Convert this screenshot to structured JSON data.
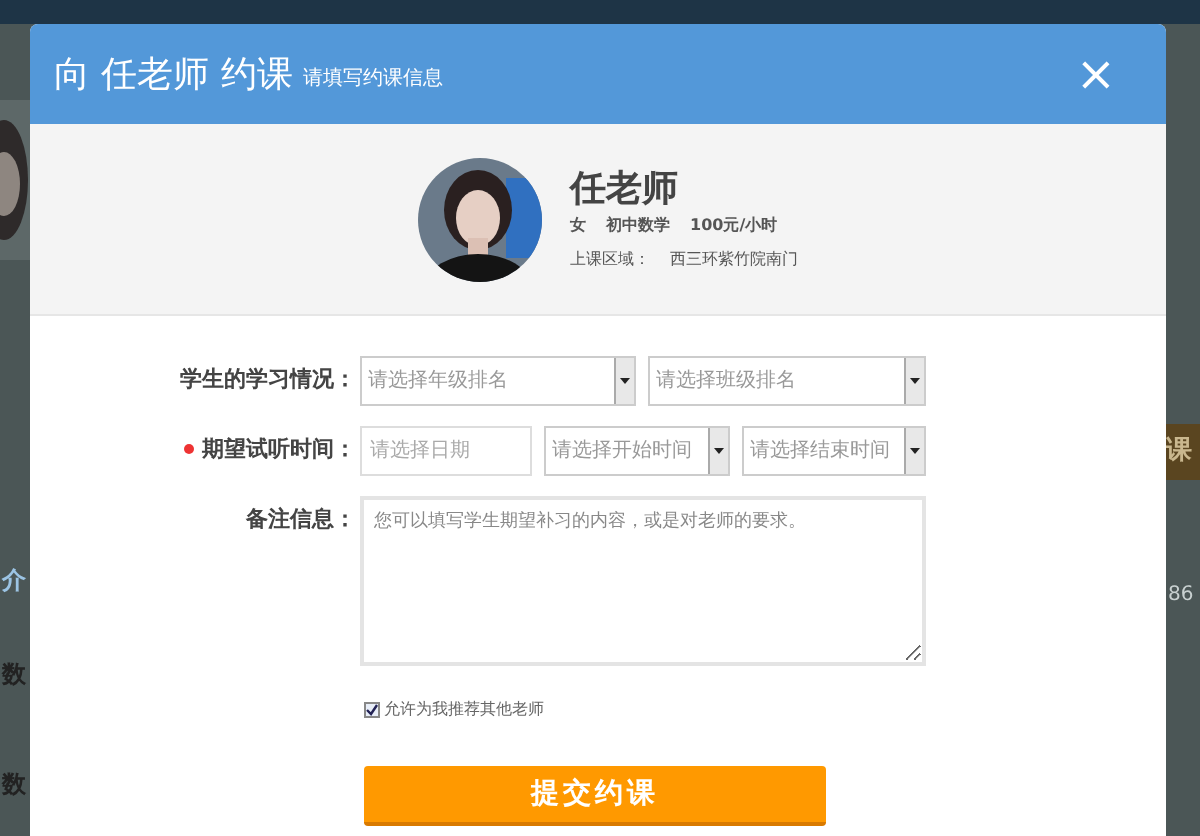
{
  "background": {
    "left_texts": [
      "介",
      "数",
      "数"
    ],
    "right_texts": [
      "课",
      "86"
    ]
  },
  "dialog": {
    "title": "向 任老师 约课",
    "subtitle": "请填写约课信息",
    "close": "×"
  },
  "teacher": {
    "name": "任老师",
    "details": [
      "女",
      "初中数学",
      "100元/小时"
    ],
    "area_label": "上课区域：",
    "area": "西三环紫竹院南门"
  },
  "form": {
    "rows": [
      {
        "label": "学生的学习情况：",
        "required": false,
        "fields": [
          {
            "kind": "select",
            "placeholder": "请选择年级排名"
          },
          {
            "kind": "select",
            "placeholder": "请选择班级排名"
          }
        ]
      },
      {
        "label": "期望试听时间：",
        "required": true,
        "fields": [
          {
            "kind": "input",
            "placeholder": "请选择日期"
          },
          {
            "kind": "select",
            "placeholder": "请选择开始时间"
          },
          {
            "kind": "select",
            "placeholder": "请选择结束时间"
          }
        ]
      },
      {
        "label": "备注信息：",
        "required": false,
        "fields": [
          {
            "kind": "textarea",
            "placeholder": "您可以填写学生期望补习的内容，或是对老师的要求。"
          }
        ]
      }
    ],
    "recommend": {
      "label": "允许为我推荐其他老师",
      "checked": true
    },
    "submit": "提交约课"
  }
}
